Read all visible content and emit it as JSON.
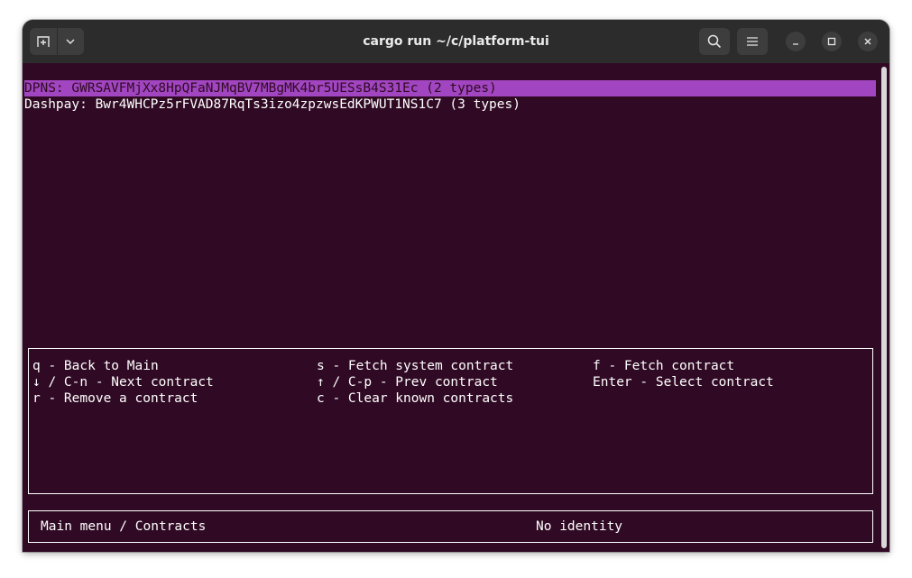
{
  "window": {
    "title": "cargo run ~/c/platform-tui"
  },
  "contracts": [
    {
      "label": "DPNS: GWRSAVFMjXx8HpQFaNJMqBV7MBgMK4br5UESsB4S31Ec (2 types)"
    },
    {
      "label": "Dashpay: Bwr4WHCPz5rFVAD87RqTs3izo4zpzwsEdKPWUT1NS1C7 (3 types)"
    }
  ],
  "keybindings": [
    [
      "q - Back to Main",
      "s - Fetch system contract",
      "f - Fetch contract"
    ],
    [
      "↓ / C-n - Next contract",
      "↑ / C-p - Prev contract",
      "Enter - Select contract"
    ],
    [
      "r - Remove a contract",
      "c - Clear known contracts",
      ""
    ]
  ],
  "status": {
    "breadcrumb": "Main menu / Contracts",
    "identity": "No identity"
  },
  "colors": {
    "terminal_bg": "#300a24",
    "selection_bg": "#a145c0",
    "titlebar_bg": "#2c2c2c"
  },
  "icons": {
    "new_tab": "new-tab-icon",
    "dropdown": "chevron-down-icon",
    "search": "search-icon",
    "menu": "hamburger-menu-icon",
    "minimize": "minimize-icon",
    "maximize": "maximize-icon",
    "close": "close-icon"
  }
}
